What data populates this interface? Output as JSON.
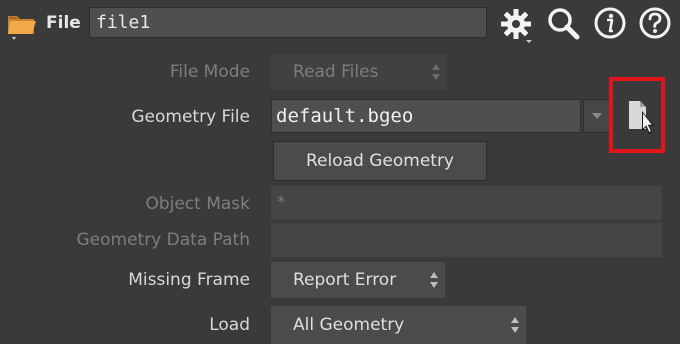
{
  "header": {
    "node_type": "File",
    "node_name": "file1",
    "icons": [
      "folder-icon",
      "gear-icon",
      "search-icon",
      "info-icon",
      "help-icon"
    ]
  },
  "params": {
    "file_mode": {
      "label": "File Mode",
      "value": "Read Files"
    },
    "geometry_file": {
      "label": "Geometry File",
      "value": "default.bgeo"
    },
    "reload_button": "Reload Geometry",
    "object_mask": {
      "label": "Object Mask",
      "value": "*"
    },
    "geometry_data_path": {
      "label": "Geometry Data Path",
      "value": ""
    },
    "missing_frame": {
      "label": "Missing Frame",
      "value": "Report Error"
    },
    "load": {
      "label": "Load",
      "value": "All Geometry"
    }
  },
  "colors": {
    "background": "#3a3a3a",
    "highlight": "#e1141c",
    "field": "#4f4f4f"
  }
}
